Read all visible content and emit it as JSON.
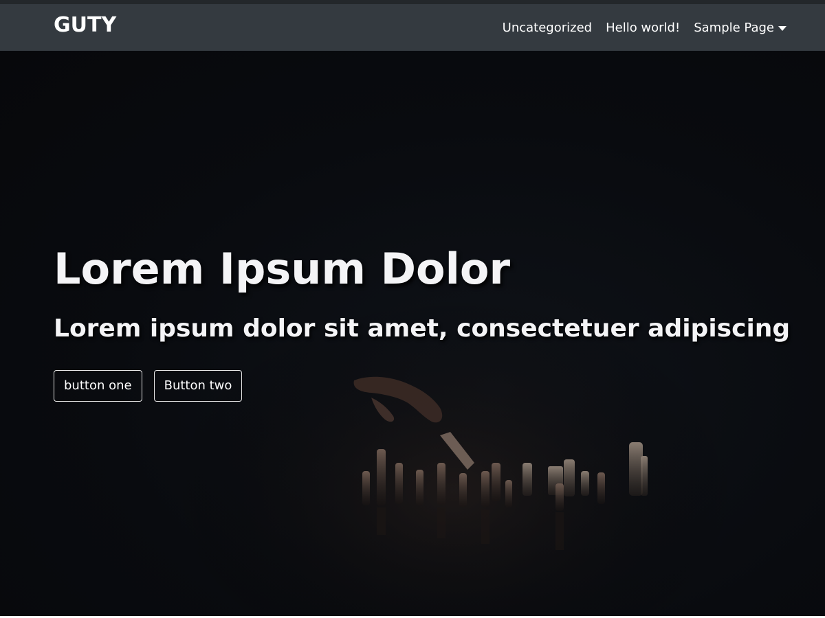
{
  "navbar": {
    "brand": "GUTY",
    "links": [
      {
        "label": "Uncategorized"
      },
      {
        "label": "Hello world!"
      },
      {
        "label": "Sample Page",
        "has_dropdown": true
      }
    ]
  },
  "hero": {
    "title": "Lorem Ipsum Dolor",
    "subtitle": "Lorem ipsum dolor sit amet, consectetuer adipiscing",
    "buttons": [
      {
        "label": "button one"
      },
      {
        "label": "Button two"
      }
    ],
    "background_image": "chess-pieces-dark-photo"
  },
  "colors": {
    "navbar_bg": "#343a40",
    "hero_bg": "#090b0f",
    "text": "#ffffff"
  }
}
